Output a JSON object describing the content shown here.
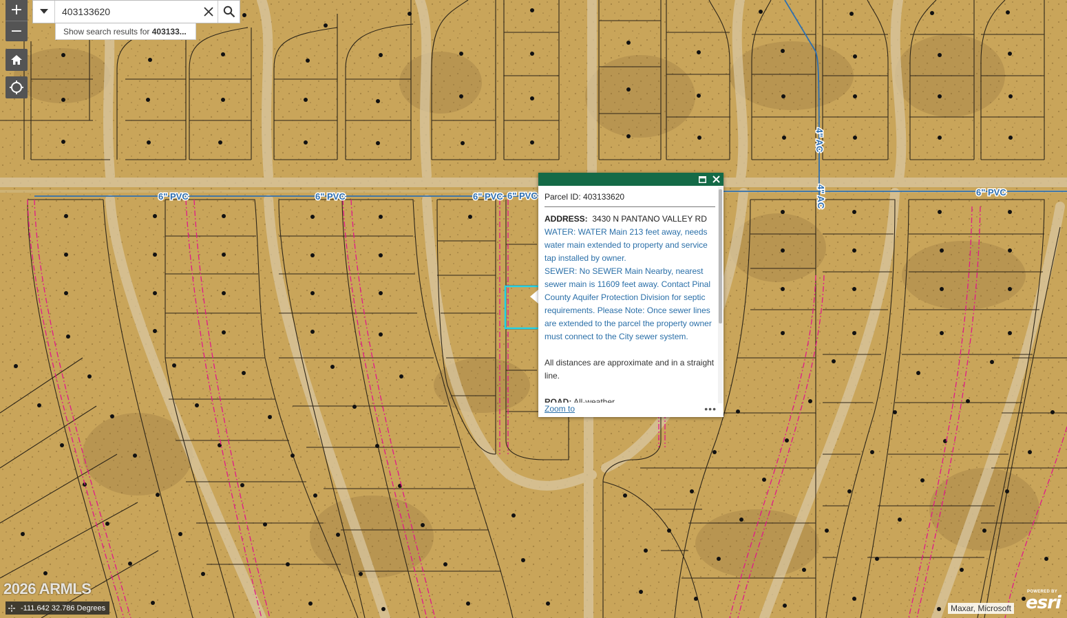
{
  "map": {
    "pipe_labels": [
      "6\" PVC",
      "6\" PVC",
      "6\" PVC",
      "6\" PVC",
      "6\" PVC",
      "4\" AC",
      "4\" AC"
    ]
  },
  "controls": {
    "zoom_in": "+",
    "zoom_out": "−",
    "home_icon": "home-icon",
    "locate_icon": "locate-icon"
  },
  "search": {
    "value": "403133620",
    "suggestion_prefix": "Show search results for ",
    "suggestion_term": "403133..."
  },
  "popup": {
    "title": "Parcel ID: 403133620",
    "address_label": "ADDRESS:",
    "address_value": "3430 N PANTANO VALLEY RD",
    "water": "WATER: WATER Main 213 feet away, needs water main extended to property and service tap installed by owner.",
    "sewer": "SEWER: No SEWER Main Nearby, nearest sewer main is 11609 feet away. Contact Pinal County Aquifer Protection Division for septic requirements. Please Note: Once sewer lines are extended to the parcel the property owner must connect to the City sewer system.",
    "distances_note": "All distances are approximate and in a straight line.",
    "road_label": "ROAD:",
    "road_value": "All-weather",
    "zoom_to": "Zoom to",
    "more": "•••"
  },
  "footer": {
    "coordinates": "-111.642 32.786 Degrees",
    "watermark": "2026 ARMLS",
    "attribution": "Maxar, Microsoft",
    "powered_by": "POWERED BY",
    "esri": "esri"
  },
  "colors": {
    "ground": "#c9a55a",
    "parcel_line": "#2b2418",
    "water_main": "#2e6fb0",
    "sewer_dash": "#e0188a",
    "popup_header": "#146a47",
    "selection": "#22d3e8"
  }
}
